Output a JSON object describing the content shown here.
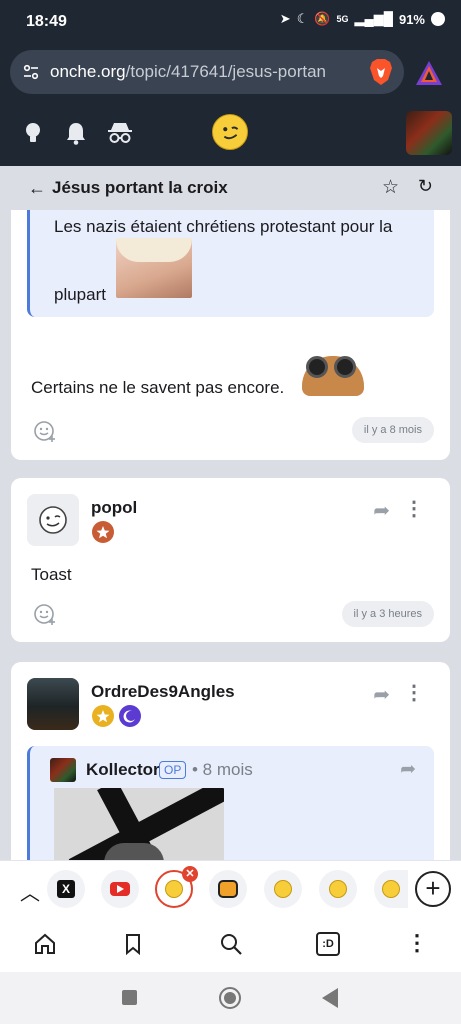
{
  "status": {
    "time": "18:49",
    "battery": "91%",
    "network": "5G"
  },
  "browser": {
    "url_host": "onche.org",
    "url_path": "/topic/417641/jesus-portan"
  },
  "topic": {
    "title": "Jésus portant la croix"
  },
  "post1": {
    "quote_text_1": "Les nazis étaient chrétiens protestant pour la",
    "quote_text_2": "plupart",
    "body": "Certains ne le savent pas encore.",
    "time": "il y a 8 mois"
  },
  "post2": {
    "author": "popol",
    "body": "Toast",
    "time": "il y a 3 heures"
  },
  "post3": {
    "author": "OrdreDes9Angles",
    "quoted_author": "Kollector",
    "op_badge": "OP",
    "quoted_time": "• 8 mois"
  },
  "tabstrip": {
    "chevron": "^"
  },
  "colors": {
    "accent": "#4c7bd9",
    "header_bg": "#1f2733",
    "quote_bg": "#e9eefc",
    "tab_active": "#e0442e"
  }
}
